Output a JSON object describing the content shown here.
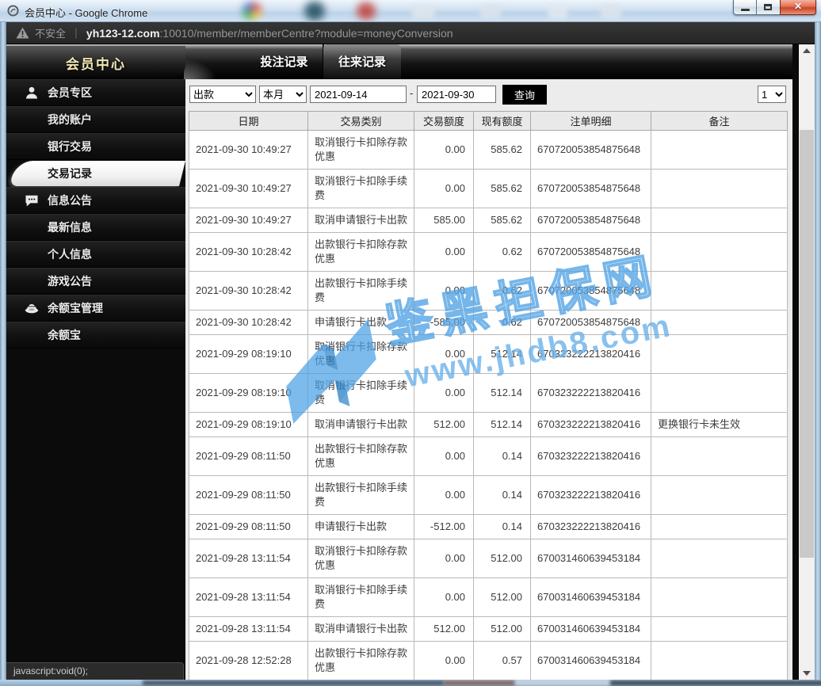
{
  "window": {
    "title": "会员中心 - Google Chrome",
    "controls": {
      "minimize": "minimize",
      "maximize": "maximize",
      "close": "close"
    }
  },
  "urlbar": {
    "warning_label": "不安全",
    "separator": "|",
    "domain": "yh123-12.com",
    "path": ":10010/member/memberCentre?module=moneyConversion"
  },
  "sidebar": {
    "header": "会员中心",
    "items": [
      {
        "name": "sidebar-section-member-zone",
        "label": "会员专区",
        "type": "section",
        "icon": "user-icon",
        "selected": false
      },
      {
        "name": "sidebar-item-my-account",
        "label": "我的账户",
        "type": "sub",
        "selected": false
      },
      {
        "name": "sidebar-item-bank-transactions",
        "label": "银行交易",
        "type": "sub",
        "selected": false
      },
      {
        "name": "sidebar-item-transaction-records",
        "label": "交易记录",
        "type": "sub",
        "selected": true
      },
      {
        "name": "sidebar-section-announcements",
        "label": "信息公告",
        "type": "section",
        "icon": "chat-icon",
        "selected": false
      },
      {
        "name": "sidebar-item-latest-news",
        "label": "最新信息",
        "type": "sub",
        "selected": false
      },
      {
        "name": "sidebar-item-personal-messages",
        "label": "个人信息",
        "type": "sub",
        "selected": false
      },
      {
        "name": "sidebar-item-game-notices",
        "label": "游戏公告",
        "type": "sub",
        "selected": false
      },
      {
        "name": "sidebar-section-yuebao-management",
        "label": "余额宝管理",
        "type": "section",
        "icon": "ingot-icon",
        "selected": false
      },
      {
        "name": "sidebar-item-yuebao",
        "label": "余额宝",
        "type": "sub",
        "selected": false
      }
    ]
  },
  "tabs": [
    {
      "name": "tab-bet-records",
      "label": "投注记录",
      "selected": false
    },
    {
      "name": "tab-transaction-records",
      "label": "往来记录",
      "selected": true
    }
  ],
  "filters": {
    "type_select": "出款",
    "period_select": "本月",
    "date_from": "2021-09-14",
    "separator": "-",
    "date_to": "2021-09-30",
    "search_button": "查询",
    "page_select": "1"
  },
  "table": {
    "columns": [
      "日期",
      "交易类别",
      "交易额度",
      "现有额度",
      "注单明细",
      "备注"
    ],
    "rows": [
      [
        "2021-09-30 10:49:27",
        "取消银行卡扣除存款优惠",
        "0.00",
        "585.62",
        "670720053854875648",
        ""
      ],
      [
        "2021-09-30 10:49:27",
        "取消银行卡扣除手续费",
        "0.00",
        "585.62",
        "670720053854875648",
        ""
      ],
      [
        "2021-09-30 10:49:27",
        "取消申请银行卡出款",
        "585.00",
        "585.62",
        "670720053854875648",
        ""
      ],
      [
        "2021-09-30 10:28:42",
        "出款银行卡扣除存款优惠",
        "0.00",
        "0.62",
        "670720053854875648",
        ""
      ],
      [
        "2021-09-30 10:28:42",
        "出款银行卡扣除手续费",
        "0.00",
        "0.62",
        "670720053854875648",
        ""
      ],
      [
        "2021-09-30 10:28:42",
        "申请银行卡出款",
        "-585.00",
        "0.62",
        "670720053854875648",
        ""
      ],
      [
        "2021-09-29 08:19:10",
        "取消银行卡扣除存款优惠",
        "0.00",
        "512.14",
        "670323222213820416",
        ""
      ],
      [
        "2021-09-29 08:19:10",
        "取消银行卡扣除手续费",
        "0.00",
        "512.14",
        "670323222213820416",
        ""
      ],
      [
        "2021-09-29 08:19:10",
        "取消申请银行卡出款",
        "512.00",
        "512.14",
        "670323222213820416",
        "更换银行卡未生效"
      ],
      [
        "2021-09-29 08:11:50",
        "出款银行卡扣除存款优惠",
        "0.00",
        "0.14",
        "670323222213820416",
        ""
      ],
      [
        "2021-09-29 08:11:50",
        "出款银行卡扣除手续费",
        "0.00",
        "0.14",
        "670323222213820416",
        ""
      ],
      [
        "2021-09-29 08:11:50",
        "申请银行卡出款",
        "-512.00",
        "0.14",
        "670323222213820416",
        ""
      ],
      [
        "2021-09-28 13:11:54",
        "取消银行卡扣除存款优惠",
        "0.00",
        "512.00",
        "670031460639453184",
        ""
      ],
      [
        "2021-09-28 13:11:54",
        "取消银行卡扣除手续费",
        "0.00",
        "512.00",
        "670031460639453184",
        ""
      ],
      [
        "2021-09-28 13:11:54",
        "取消申请银行卡出款",
        "512.00",
        "512.00",
        "670031460639453184",
        ""
      ],
      [
        "2021-09-28 12:52:28",
        "出款银行卡扣除存款优惠",
        "0.00",
        "0.57",
        "670031460639453184",
        ""
      ]
    ]
  },
  "watermark": {
    "text": "鉴黑担保网",
    "url": "www.jhdb8.com",
    "color": "#55a5e5"
  },
  "statusbar": {
    "text": "javascript:void(0);"
  }
}
